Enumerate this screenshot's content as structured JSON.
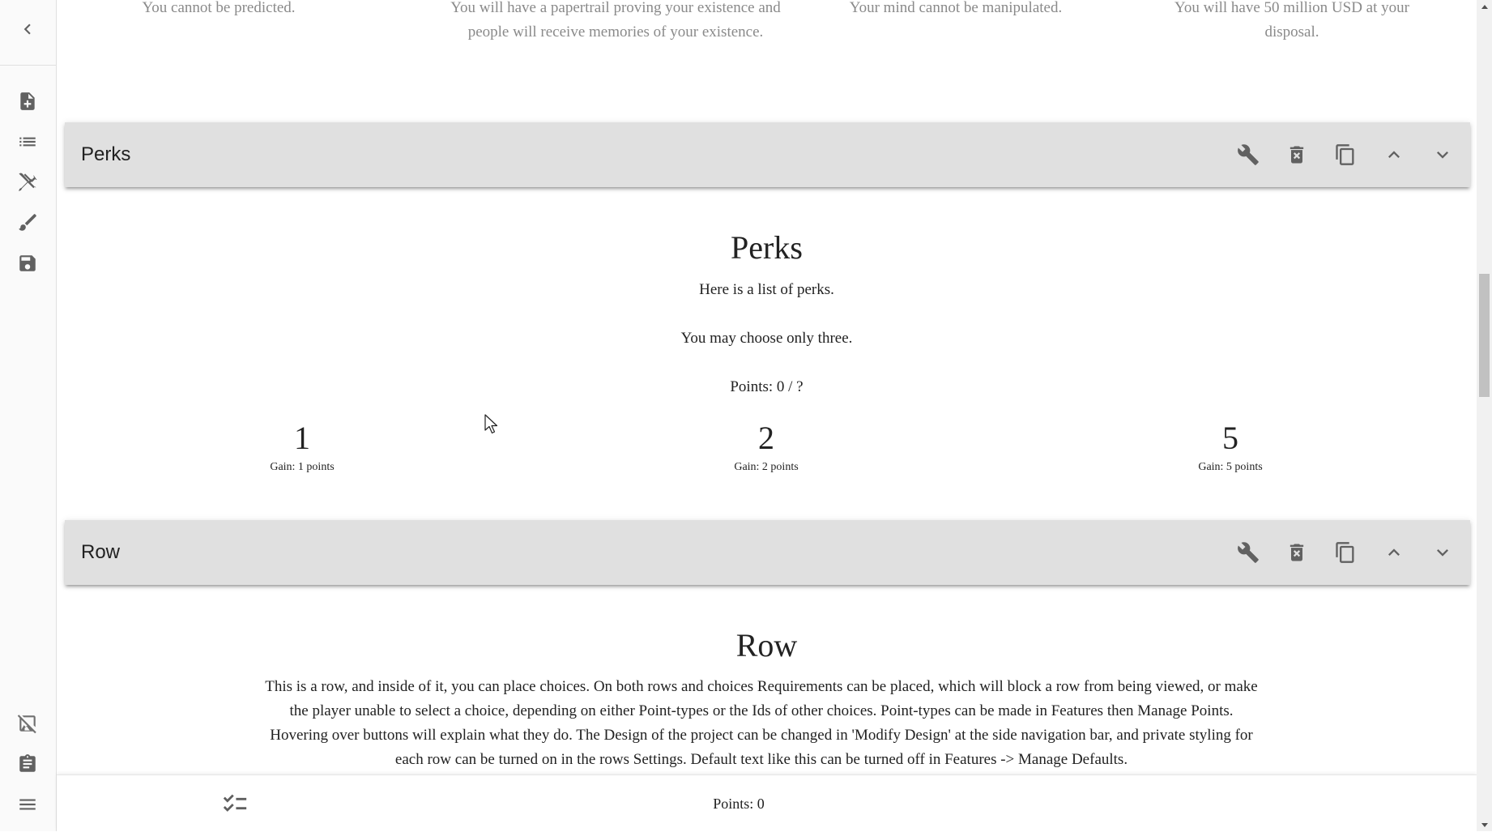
{
  "sidebar": {
    "back_icon": "chevron-left-icon",
    "items": [
      {
        "name": "new-document-icon"
      },
      {
        "name": "list-icon"
      },
      {
        "name": "tools-icon"
      },
      {
        "name": "brush-icon"
      },
      {
        "name": "save-icon"
      }
    ],
    "bottom_items": [
      {
        "name": "image-off-icon"
      },
      {
        "name": "clipboard-icon"
      },
      {
        "name": "menu-icon"
      }
    ]
  },
  "top_choices": [
    {
      "text": "You cannot be predicted."
    },
    {
      "text": "You will have a papertrail proving your existence and people will receive memories of your existence."
    },
    {
      "text": "Your mind cannot be manipulated."
    },
    {
      "text": "You will have 50 million USD at your disposal."
    }
  ],
  "perks_row": {
    "header_label": "Perks",
    "title": "Perks",
    "text_line_1": "Here is a list of perks.",
    "text_line_2": "You may choose only three.",
    "points_line": "Points: 0 / ?",
    "choices": [
      {
        "title": "1",
        "gain": "Gain: 1 points"
      },
      {
        "title": "2",
        "gain": "Gain: 2 points"
      },
      {
        "title": "5",
        "gain": "Gain: 5 points"
      }
    ]
  },
  "row_row": {
    "header_label": "Row",
    "title": "Row",
    "description": "This is a row, and inside of it, you can place choices. On both rows and choices Requirements can be placed, which will block a row from being viewed, or make the player unable to select a choice, depending on either Point-types or the Ids of other choices. Point-types can be made in Features then Manage Points. Hovering over buttons will explain what they do. The Design of the project can be changed in 'Modify Design' at the side navigation bar, and private styling for each row can be turned on in the rows Settings. Default text like this can be turned off in Features -> Manage Defaults."
  },
  "header_actions": [
    "wrench-icon",
    "delete-icon",
    "copy-icon",
    "chevron-up-icon",
    "chevron-down-icon"
  ],
  "bottom_bar": {
    "icon": "checklist-icon",
    "points": "Points: 0"
  },
  "colors": {
    "header_bg": "#e0e0e0",
    "icon": "#616161",
    "muted_text": "#8a8a8a"
  }
}
